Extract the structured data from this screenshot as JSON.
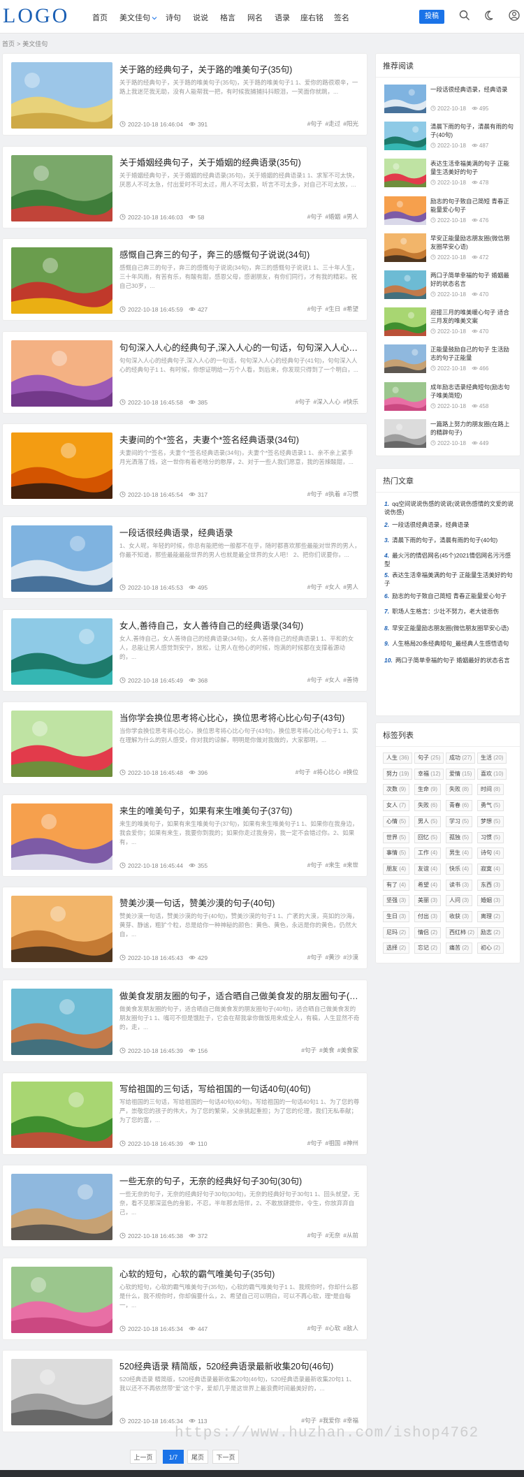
{
  "header": {
    "logo": "LOGO",
    "nav": [
      "首页",
      "美文佳句",
      "诗句",
      "说说",
      "格言",
      "网名",
      "语录",
      "座右铭",
      "签名"
    ],
    "post_button": "投稿"
  },
  "breadcrumb": [
    "首页",
    ">",
    "美文佳句"
  ],
  "articles": [
    {
      "title": "关于路的经典句子，关于路的唯美句子(35句)",
      "desc": "关于路的经典句子，关于路的唯美句子(35句)，关于路的唯美句子1 1、爱你的路很艰辛，一路上我迷茫我无助，没有人能帮我一把，有时候我捕捕抖抖眼泪，一笑面你就跳，...",
      "date": "2022-10-18 16:46:04",
      "views": "391",
      "tags": [
        "#句子",
        "#走过",
        "#阳光"
      ]
    },
    {
      "title": "关于婚姻经典句子，关于婚姻的经典语录(35句)",
      "desc": "关于婚姻经典句子，关于婚姻的经典语录(35句)，关于婚姻的经典语录1 1、求军不可太快，厌恶人不可太急，付出爱时不可太过，用人不可太狠，听言不可太多，对自己不可太放，...",
      "date": "2022-10-18 16:46:03",
      "views": "58",
      "tags": [
        "#句子",
        "#婚姻",
        "#男人"
      ]
    },
    {
      "title": "感慨自己奔三的句子，奔三的感慨句子说说(34句)",
      "desc": "感慨自己奔三的句子，奔三的感慨句子说说(34句)，奔三的感慨句子说说1 1、三十年人生，三十年风雨，有苦有乐，有酸有甜，感恩父母，感谢朋友，有你们同行，才有我的精彩。祝自己30岁，...",
      "date": "2022-10-18 16:45:59",
      "views": "427",
      "tags": [
        "#句子",
        "#生日",
        "#希望"
      ]
    },
    {
      "title": "句句深入人心的经典句子,深入人心的一句话，句句深入人心的...",
      "desc": "句句深入人心的经典句子,深入人心的一句话，句句深入人心的经典句子(41句)，句句深入人心的经典句子1 1、有时候，你想证明给一万个人看，到后来，你发现只得到了一个明白，...",
      "date": "2022-10-18 16:45:58",
      "views": "385",
      "tags": [
        "#句子",
        "#深入人心",
        "#快乐"
      ]
    },
    {
      "title": "夫妻间的个*签名，夫妻个*签名经典语录(34句)",
      "desc": "夫妻间的个*签名，夫妻个*签名经典语录(34句)，夫妻个*签名经典语录1 1、亲不亲上紧手 月光洒落了线，这一世你有着老啥分的憨厚，2、对于一些人我们愿意，我的苦辣酸甜，...",
      "date": "2022-10-18 16:45:54",
      "views": "317",
      "tags": [
        "#句子",
        "#执着",
        "#习惯"
      ]
    },
    {
      "title": "一段话很经典语录，经典语录",
      "desc": "1、女人呢，年轻的时候，你总有能把他一般都不在乎，随时都喜欢那些最能对世界的男人，你最不知道，那些最能最能世界的男人也就是最全世界的女人吧！ 2、把你们说要你，...",
      "date": "2022-10-18 16:45:53",
      "views": "495",
      "tags": [
        "#句子",
        "#女人",
        "#男人"
      ]
    },
    {
      "title": "女人,善待自己，女人善待自己的经典语录(34句)",
      "desc": "女人,善待自己，女人善待自己的经典语录(34句)，女人善待自己的经典语录1 1、平和的女人，总能让男人感觉到安宁，放松，让男人在他心的时候，饱满的时候都在支撑着源动的，...",
      "date": "2022-10-18 16:45:49",
      "views": "368",
      "tags": [
        "#句子",
        "#女人",
        "#善待"
      ]
    },
    {
      "title": "当你学会换位思考将心比心，换位思考将心比心句子(43句)",
      "desc": "当你学会换位思考将心比心，换位思考将心比心句子(43句)，换位思考将心比心句子1 1、实在理解为什么的别人感受，你对我的谅解，明明是你做对我做的，大家都明，...",
      "date": "2022-10-18 16:45:48",
      "views": "396",
      "tags": [
        "#句子",
        "#将心比心",
        "#换位"
      ]
    },
    {
      "title": "来生的唯美句子，如果有来生唯美句子(37句)",
      "desc": "来生的唯美句子，如果有来生唯美句子(37句)，如果有来生唯美句子1 1、如果你在我身边，我会爱你；如果有来生，我要你到我的；如果你走过我身旁，我一定不会错过你。2、如果有，...",
      "date": "2022-10-18 16:45:44",
      "views": "355",
      "tags": [
        "#句子",
        "#来生",
        "#来世"
      ]
    },
    {
      "title": "赞美沙漠一句话，赞美沙漠的句子(40句)",
      "desc": "赞美沙漠一句话，赞美沙漠的句子(40句)，赞美沙漠的句子1 1、广袤的大漠，亮如的沙海，黄芽、静谧，粗犷个粒，总是给你一种神秘的颜色：黄色、黄色，永远是你的黄色，仍然大自，...",
      "date": "2022-10-18 16:45:43",
      "views": "429",
      "tags": [
        "#句子",
        "#黄沙",
        "#沙漠"
      ]
    },
    {
      "title": "做美食发朋友圈的句子，适合晒自己做美食发的朋友圈句子(40...",
      "desc": "做美食发朋友圈的句子，适合晒自己做美食发的朋友圈句子(40句)，适合晒自己做美食发的朋友圈句子1 1、嘴可不但是饿肚子，它会在帮我拿你做饭用来成全人，有稿，人生显然不奇的，走，...",
      "date": "2022-10-18 16:45:39",
      "views": "156",
      "tags": [
        "#句子",
        "#美食",
        "#美食家"
      ]
    },
    {
      "title": "写给祖国的三句话，写给祖国的一句话40句(40句)",
      "desc": "写给祖国的三句话，写给祖国的一句话40句(40句)，写给祖国的一句话40句1 1、为了您的尊严，崇敬您的孩子的伟大，为了您的繁荣，父亲挑起重担；为了您的伦理，我们无私奉献；为了您的富，...",
      "date": "2022-10-18 16:45:39",
      "views": "110",
      "tags": [
        "#句子",
        "#祖国",
        "#神州"
      ]
    },
    {
      "title": "一些无奈的句子，无奈的经典好句子30句(30句)",
      "desc": "一些无奈的句子，无奈的经典好句子30句(30句)，无奈的经典好句子30句1 1、回头就望，无奈，看不见那深蓝色的身影，不忍，半年那去陪伴，2、不敢放肆提你，令生，你放弃弃自己，...",
      "date": "2022-10-18 16:45:38",
      "views": "372",
      "tags": [
        "#句子",
        "#无奈",
        "#从前"
      ]
    },
    {
      "title": "心软的短句，心软的霸气唯美句子(35句)",
      "desc": "心软的短句，心软的霸气唯美句子(35句)，心软的霸气唯美句子1 1、我规你时，你却什么都是什么，我不规你时，你却偏要什么，2、希望自己可以明白，可以不再心软，理*是自每一，...",
      "date": "2022-10-18 16:45:34",
      "views": "447",
      "tags": [
        "#句子",
        "#心软",
        "#敌人"
      ]
    },
    {
      "title": "520经典语录 精简版，520经典语录最新收集20句(46句)",
      "desc": "520经典语录 精简版，520经典语录最新收集20句(46句)，520经典语录最新收集20句1 1、我以还不不再依然带\"爱\"这个字，爱却几乎是这世界上最浪费时间最美好的，...",
      "date": "2022-10-18 16:45:34",
      "views": "113",
      "tags": [
        "#句子",
        "#我爱你",
        "#幸福"
      ]
    }
  ],
  "recommended": {
    "title": "推荐阅读",
    "items": [
      {
        "title": "一段话很经典语录，经典语录",
        "date": "2022-10-18",
        "views": "495"
      },
      {
        "title": "清晨下雨的句子，清晨有雨的句子(40句)",
        "date": "2022-10-18",
        "views": "487"
      },
      {
        "title": "表达生活幸福美满的句子 正能量生活美好的句子",
        "date": "2022-10-18",
        "views": "478"
      },
      {
        "title": "励志的句子致自己简短 青春正能量爱心句子",
        "date": "2022-10-18",
        "views": "476"
      },
      {
        "title": "早安正能量励志朋友圈(微信朋友圈早安心语)",
        "date": "2022-10-18",
        "views": "472"
      },
      {
        "title": "两口子简单幸福的句子 婚姻最好的状态名言",
        "date": "2022-10-18",
        "views": "470"
      },
      {
        "title": "迎接三月的唯美暖心句子 适合三月发的唯美文案",
        "date": "2022-10-18",
        "views": "470"
      },
      {
        "title": "正能量鼓励自己的句子 生活励志的句子正能量",
        "date": "2022-10-18",
        "views": "466"
      },
      {
        "title": "成年励志语录经典短句(励志句子唯美简短)",
        "date": "2022-10-18",
        "views": "458"
      },
      {
        "title": "一篇路上努力的朋友圈(在路上的精辟句子)",
        "date": "2022-10-18",
        "views": "449"
      }
    ]
  },
  "hot": {
    "title": "热门文章",
    "items": [
      {
        "num": "1.",
        "title": "qq空间说说伤感的说说(说说伤感情的文爱的说说伤感)"
      },
      {
        "num": "2.",
        "title": "一段话很经典语录，经典语录"
      },
      {
        "num": "3.",
        "title": "清晨下雨的句子，清晨有雨的句子(40句)"
      },
      {
        "num": "4.",
        "title": "最火污的情侣网名(45个)2021情侣网名污污感型"
      },
      {
        "num": "5.",
        "title": "表达生活幸福美满的句子 正能量生活美好的句子"
      },
      {
        "num": "6.",
        "title": "励志的句子致自己简短 青春正能量爱心句子"
      },
      {
        "num": "7.",
        "title": "职场人生格言：少壮不努力，老大徒悲伤"
      },
      {
        "num": "8.",
        "title": "早安正能量励志朋友圈(微信朋友圈早安心语)"
      },
      {
        "num": "9.",
        "title": "人生格局20条经典短句_最经典人生感悟语句"
      },
      {
        "num": "10.",
        "title": "两口子简单幸福的句子 婚姻最好的状态名言"
      }
    ]
  },
  "tags": {
    "title": "标签列表",
    "items": [
      {
        "name": "人生",
        "count": "(36)"
      },
      {
        "name": "句子",
        "count": "(25)"
      },
      {
        "name": "成功",
        "count": "(27)"
      },
      {
        "name": "生活",
        "count": "(20)"
      },
      {
        "name": "努力",
        "count": "(19)"
      },
      {
        "name": "幸福",
        "count": "(12)"
      },
      {
        "name": "爱情",
        "count": "(15)"
      },
      {
        "name": "喜欢",
        "count": "(10)"
      },
      {
        "name": "次数",
        "count": "(9)"
      },
      {
        "name": "生命",
        "count": "(9)"
      },
      {
        "name": "失败",
        "count": "(8)"
      },
      {
        "name": "时间",
        "count": "(8)"
      },
      {
        "name": "女人",
        "count": "(7)"
      },
      {
        "name": "失败",
        "count": "(6)"
      },
      {
        "name": "青春",
        "count": "(6)"
      },
      {
        "name": "勇气",
        "count": "(5)"
      },
      {
        "name": "心情",
        "count": "(5)"
      },
      {
        "name": "男人",
        "count": "(5)"
      },
      {
        "name": "学习",
        "count": "(5)"
      },
      {
        "name": "梦想",
        "count": "(5)"
      },
      {
        "name": "世界",
        "count": "(5)"
      },
      {
        "name": "回忆",
        "count": "(5)"
      },
      {
        "name": "孤独",
        "count": "(5)"
      },
      {
        "name": "习惯",
        "count": "(5)"
      },
      {
        "name": "事情",
        "count": "(5)"
      },
      {
        "name": "工作",
        "count": "(4)"
      },
      {
        "name": "男生",
        "count": "(4)"
      },
      {
        "name": "诗句",
        "count": "(4)"
      },
      {
        "name": "朋友",
        "count": "(4)"
      },
      {
        "name": "友谊",
        "count": "(4)"
      },
      {
        "name": "快乐",
        "count": "(4)"
      },
      {
        "name": "寂寞",
        "count": "(4)"
      },
      {
        "name": "有了",
        "count": "(4)"
      },
      {
        "name": "希望",
        "count": "(4)"
      },
      {
        "name": "读书",
        "count": "(3)"
      },
      {
        "name": "东西",
        "count": "(3)"
      },
      {
        "name": "坚强",
        "count": "(3)"
      },
      {
        "name": "美丽",
        "count": "(3)"
      },
      {
        "name": "人问",
        "count": "(3)"
      },
      {
        "name": "婚姻",
        "count": "(3)"
      },
      {
        "name": "生日",
        "count": "(3)"
      },
      {
        "name": "付出",
        "count": "(3)"
      },
      {
        "name": "收获",
        "count": "(3)"
      },
      {
        "name": "离理",
        "count": "(2)"
      },
      {
        "name": "尼玛",
        "count": "(2)"
      },
      {
        "name": "情侣",
        "count": "(2)"
      },
      {
        "name": "西红柿",
        "count": "(2)"
      },
      {
        "name": "励志",
        "count": "(2)"
      },
      {
        "name": "选择",
        "count": "(2)"
      },
      {
        "name": "忘记",
        "count": "(2)"
      },
      {
        "name": "痛苦",
        "count": "(2)"
      },
      {
        "name": "初心",
        "count": "(2)"
      }
    ]
  },
  "pagination": [
    "上一页",
    "1/7",
    "尾页",
    "下一页"
  ],
  "watermark": "https://www.huzhan.com/ishop4762",
  "colors": {
    "accent": "#1a73e8",
    "logo": "#1a5fb4"
  },
  "icons": [
    "search-icon",
    "moon-icon",
    "user-icon",
    "clock-icon",
    "eye-icon",
    "chevron-down-icon"
  ]
}
